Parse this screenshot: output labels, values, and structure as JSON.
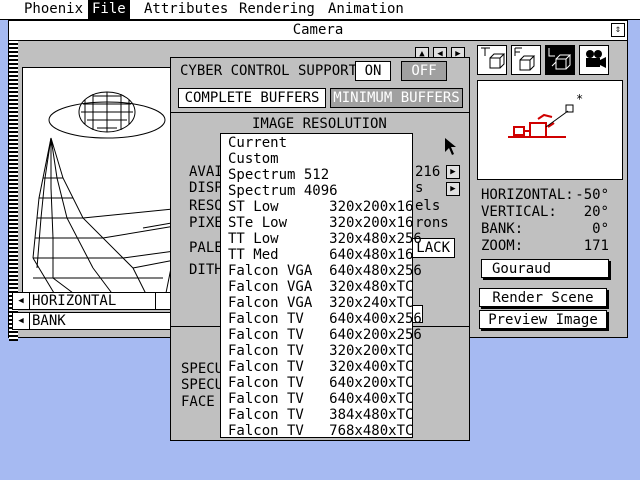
{
  "menubar": {
    "items": [
      {
        "label": "Phoenix"
      },
      {
        "label": "File",
        "active": true
      },
      {
        "label": "Attributes"
      },
      {
        "label": "Rendering"
      },
      {
        "label": "Animation"
      }
    ]
  },
  "window": {
    "title": "Camera",
    "sliders": [
      {
        "label": "HORIZONTAL"
      },
      {
        "label": "BANK"
      }
    ],
    "camera": {
      "horizontal": {
        "label": "HORIZONTAL:",
        "value": "-50°"
      },
      "vertical": {
        "label": "VERTICAL:",
        "value": "20°"
      },
      "bank": {
        "label": "BANK:",
        "value": "0°"
      },
      "zoom": {
        "label": "ZOOM:",
        "value": "171"
      }
    },
    "shading_label": "Gouraud",
    "render_scene_label": "Render Scene",
    "preview_image_label": "Preview Image"
  },
  "dialog": {
    "cyber_label": "CYBER CONTROL SUPPORT",
    "on_label": "ON",
    "off_label": "OFF",
    "complete_buffers_label": "COMPLETE BUFFERS",
    "minimum_buffers_label": "MINIMUM BUFFERS",
    "image_resolution_label": "IMAGE RESOLUTION",
    "partial": {
      "avai": "AVAI",
      "disp": "DISP",
      "reso": "RESO",
      "pixe": "PIXE",
      "pale": "PALE",
      "dith": "DITH",
      "num_216": "216",
      "s": "s",
      "els": "els",
      "rons": "rons",
      "lack": "LACK",
      "specu1": "SPECU",
      "specu2": "SPECU",
      "face": "FACE"
    }
  },
  "popup": {
    "items": [
      "Current",
      "Custom",
      "Spectrum 512",
      "Spectrum 4096",
      "ST Low      320x200x16",
      "STe Low     320x200x16",
      "TT Low      320x480x256",
      "TT Med      640x480x16",
      "Falcon VGA  640x480x256",
      "Falcon VGA  320x480xTC",
      "Falcon VGA  320x240xTC",
      "Falcon TV   640x400x256",
      "Falcon TV   640x200x256",
      "Falcon TV   320x200xTC",
      "Falcon TV   320x400xTC",
      "Falcon TV   640x200xTC",
      "Falcon TV   640x400xTC",
      "Falcon TV   384x480xTC",
      "Falcon TV   768x480xTC"
    ]
  }
}
